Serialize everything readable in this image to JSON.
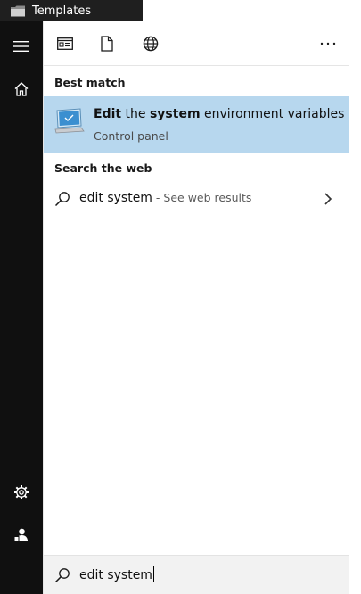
{
  "background_window": {
    "title": "Templates"
  },
  "rail": {
    "menu_icon": "hamburger-menu-icon",
    "home_icon": "home-icon",
    "settings_icon": "gear-icon",
    "account_icon": "user-icon"
  },
  "toolbar": {
    "apps_icon": "apps-filter-icon",
    "documents_icon": "document-icon",
    "web_icon": "globe-icon",
    "more_icon": "ellipsis-icon"
  },
  "best_match": {
    "header": "Best match",
    "item": {
      "word1": "Edit",
      "word2": " the ",
      "word3": "system",
      "word4": " environment variables",
      "subtitle": "Control panel",
      "icon": "system-properties-icon",
      "selected_color": "#b7d7ee"
    }
  },
  "search_web": {
    "header": "Search the web",
    "query": "edit system",
    "hint": " - See web results"
  },
  "search_box": {
    "value": "edit system"
  },
  "colors": {
    "rail_bg": "#101010",
    "selection": "#b7d7ee"
  }
}
